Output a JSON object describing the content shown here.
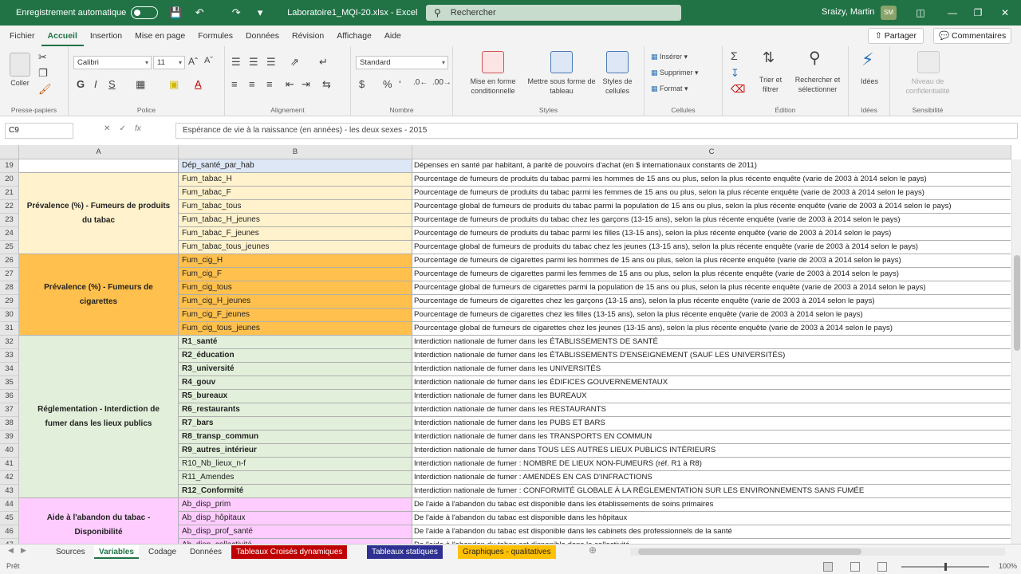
{
  "titlebar": {
    "autosave_label": "Enregistrement automatique",
    "filename": "Laboratoire1_MQI-20.xlsx",
    "app": "Excel",
    "search_placeholder": "Rechercher",
    "user": "Sraizy, Martin",
    "avatar_initials": "SM"
  },
  "tabs": [
    "Fichier",
    "Accueil",
    "Insertion",
    "Mise en page",
    "Formules",
    "Données",
    "Révision",
    "Affichage",
    "Aide"
  ],
  "share_label": "Partager",
  "comments_label": "Commentaires",
  "ribbon": {
    "clipboard": {
      "label": "Presse-papiers",
      "paste": "Coller"
    },
    "font": {
      "label": "Police",
      "name": "Calibri",
      "size": "11"
    },
    "alignment": {
      "label": "Alignement"
    },
    "number": {
      "label": "Nombre",
      "format": "Standard"
    },
    "styles": {
      "label": "Styles",
      "cond": "Mise en forme conditionnelle",
      "table": "Mettre sous forme de tableau",
      "cell": "Styles de cellules"
    },
    "cells": {
      "label": "Cellules",
      "insert": "Insérer",
      "delete": "Supprimer",
      "format": "Format"
    },
    "editing": {
      "label": "Édition",
      "sort": "Trier et filtrer",
      "find": "Rechercher et sélectionner"
    },
    "ideas": {
      "label": "Idées",
      "btn": "Idées"
    },
    "sensitivity": {
      "label": "Sensibilité",
      "btn": "Niveau de confidentialité"
    }
  },
  "formula_bar": {
    "name_box": "C9",
    "content": "Espérance de vie à la naissance (en années) - les deux sexes - 2015"
  },
  "columns": [
    "A",
    "B",
    "C"
  ],
  "groups": [
    {
      "label": "Prévalence  (%) - Fumeurs de produits du tabac",
      "color": "#fff2cc"
    },
    {
      "label": "Prévalence (%) - Fumeurs de cigarettes",
      "color": "#ffc04d"
    },
    {
      "label": "Réglementation - Interdiction de fumer dans les lieux publics",
      "color": "#e2efda"
    },
    {
      "label": "Aide à l'abandon du tabac - Disponibilité",
      "color": "#ffccff"
    }
  ],
  "rows": [
    {
      "n": "19",
      "b": "Dép_santé_par_hab",
      "c": "Dépenses en santé par habitant, à parité de pouvoirs d'achat (en $ internationaux constants de 2011)",
      "bcolor": "#dde7f5",
      "bold": false
    },
    {
      "n": "20",
      "b": "Fum_tabac_H",
      "c": "Pourcentage de fumeurs de produits du tabac parmi les hommes de 15 ans ou plus, selon la plus récente enquête (varie de 2003 à 2014 selon le pays)",
      "bcolor": "#fff2cc",
      "bold": false
    },
    {
      "n": "21",
      "b": "Fum_tabac_F",
      "c": "Pourcentage de fumeurs de produits du tabac parmi les femmes de 15 ans ou plus, selon la plus récente enquête (varie de 2003 à 2014 selon le pays)",
      "bcolor": "#fff2cc",
      "bold": false
    },
    {
      "n": "22",
      "b": "Fum_tabac_tous",
      "c": "Pourcentage global de fumeurs de produits du tabac parmi la population de 15 ans ou plus, selon la plus récente enquête (varie de 2003 à 2014 selon le pays)",
      "bcolor": "#fff2cc",
      "bold": false
    },
    {
      "n": "23",
      "b": "Fum_tabac_H_jeunes",
      "c": "Pourcentage de fumeurs de produits du tabac chez les garçons (13-15 ans), selon la plus récente enquête (varie de 2003 à 2014 selon le pays)",
      "bcolor": "#fff2cc",
      "bold": false
    },
    {
      "n": "24",
      "b": "Fum_tabac_F_jeunes",
      "c": "Pourcentage de fumeurs de produits du tabac parmi les filles (13-15 ans), selon la plus récente enquête (varie de 2003 à 2014 selon le pays)",
      "bcolor": "#fff2cc",
      "bold": false
    },
    {
      "n": "25",
      "b": "Fum_tabac_tous_jeunes",
      "c": "Pourcentage global de fumeurs de produits du tabac chez les jeunes (13-15 ans), selon la plus récente enquête (varie de 2003 à 2014 selon le pays)",
      "bcolor": "#fff2cc",
      "bold": false
    },
    {
      "n": "26",
      "b": "Fum_cig_H",
      "c": "Pourcentage de fumeurs de cigarettes parmi les hommes de 15 ans ou plus, selon la plus récente enquête (varie de 2003 à 2014 selon le pays)",
      "bcolor": "#ffc04d",
      "bold": false
    },
    {
      "n": "27",
      "b": "Fum_cig_F",
      "c": "Pourcentage de fumeurs de cigarettes parmi les femmes de 15 ans ou plus, selon la plus récente enquête (varie de 2003 à 2014 selon le pays)",
      "bcolor": "#ffc04d",
      "bold": false
    },
    {
      "n": "28",
      "b": "Fum_cig_tous",
      "c": "Pourcentage global de fumeurs de cigarettes parmi la population de 15 ans ou plus, selon la plus récente enquête (varie de 2003 à 2014 selon le pays)",
      "bcolor": "#ffc04d",
      "bold": false
    },
    {
      "n": "29",
      "b": "Fum_cig_H_jeunes",
      "c": "Pourcentage de fumeurs de cigarettes chez les garçons (13-15 ans), selon la plus récente enquête (varie de 2003 à 2014 selon le pays)",
      "bcolor": "#ffc04d",
      "bold": false
    },
    {
      "n": "30",
      "b": "Fum_cig_F_jeunes",
      "c": "Pourcentage de fumeurs de cigarettes chez les filles (13-15 ans), selon la plus récente enquête (varie de 2003 à 2014 selon le pays)",
      "bcolor": "#ffc04d",
      "bold": false
    },
    {
      "n": "31",
      "b": "Fum_cig_tous_jeunes",
      "c": "Pourcentage global de fumeurs de cigarettes chez les jeunes (13-15 ans), selon la plus récente enquête (varie de 2003 à 2014 selon le pays)",
      "bcolor": "#ffc04d",
      "bold": false
    },
    {
      "n": "32",
      "b": "R1_santé",
      "c": "Interdiction nationale de fumer dans les ÉTABLISSEMENTS DE SANTÉ",
      "bcolor": "#e2efda",
      "bold": true
    },
    {
      "n": "33",
      "b": "R2_éducation",
      "c": "Interdiction nationale de fumer dans les ÉTABLISSEMENTS D'ENSEIGNEMENT (SAUF LES UNIVERSITÉS)",
      "bcolor": "#e2efda",
      "bold": true
    },
    {
      "n": "34",
      "b": "R3_université",
      "c": "Interdiction nationale de fumer dans les UNIVERSITÉS",
      "bcolor": "#e2efda",
      "bold": true
    },
    {
      "n": "35",
      "b": "R4_gouv",
      "c": "Interdiction nationale de fumer dans les ÉDIFICES GOUVERNEMENTAUX",
      "bcolor": "#e2efda",
      "bold": true
    },
    {
      "n": "36",
      "b": "R5_bureaux",
      "c": "Interdiction nationale de fumer dans les BUREAUX",
      "bcolor": "#e2efda",
      "bold": true
    },
    {
      "n": "37",
      "b": "R6_restaurants",
      "c": "Interdiction nationale de fumer dans les RESTAURANTS",
      "bcolor": "#e2efda",
      "bold": true
    },
    {
      "n": "38",
      "b": "R7_bars",
      "c": "Interdiction nationale de fumer dans les PUBS ET BARS",
      "bcolor": "#e2efda",
      "bold": true
    },
    {
      "n": "39",
      "b": "R8_transp_commun",
      "c": "Interdiction nationale de fumer dans les TRANSPORTS EN COMMUN",
      "bcolor": "#e2efda",
      "bold": true
    },
    {
      "n": "40",
      "b": "R9_autres_intérieur",
      "c": "Interdiction nationale de fumer dans TOUS LES AUTRES LIEUX PUBLICS INTÉRIEURS",
      "bcolor": "#e2efda",
      "bold": true
    },
    {
      "n": "41",
      "b": "R10_Nb_lieux_n-f",
      "c": "Interdiction nationale de fumer : NOMBRE DE LIEUX NON-FUMEURS (réf. R1 à R8)",
      "bcolor": "#e2efda",
      "bold": false
    },
    {
      "n": "42",
      "b": "R11_Amendes",
      "c": "Interdiction nationale de fumer : AMENDES EN CAS D'INFRACTIONS",
      "bcolor": "#e2efda",
      "bold": false
    },
    {
      "n": "43",
      "b": "R12_Conformité",
      "c": "Interdiction nationale de fumer : CONFORMITÉ GLOBALE À LA RÉGLEMENTATION SUR LES ENVIRONNEMENTS SANS FUMÉE",
      "bcolor": "#e2efda",
      "bold": true
    },
    {
      "n": "44",
      "b": "Ab_disp_prim",
      "c": "De l'aide à l'abandon du tabac est disponible dans les établissements de soins primaires",
      "bcolor": "#ffccff",
      "bold": false
    },
    {
      "n": "45",
      "b": "Ab_disp_hôpitaux",
      "c": "De l'aide à l'abandon du tabac est disponible dans les hôpitaux",
      "bcolor": "#ffccff",
      "bold": false
    },
    {
      "n": "46",
      "b": "Ab_disp_prof_santé",
      "c": "De l'aide à l'abandon du tabac est disponible dans les cabinets des professionnels de la santé",
      "bcolor": "#ffccff",
      "bold": false
    },
    {
      "n": "47",
      "b": "Ab_disp_collectivité",
      "c": "De l'aide à l'abandon du tabac est disponible dans la collectivité",
      "bcolor": "#ffccff",
      "bold": false
    }
  ],
  "sheets": [
    {
      "name": "Sources",
      "color": ""
    },
    {
      "name": "Variables",
      "color": "",
      "active": true
    },
    {
      "name": "Codage",
      "color": ""
    },
    {
      "name": "Données",
      "color": ""
    },
    {
      "name": "Tableaux Croisés dynamiques",
      "color": "#c00000"
    },
    {
      "name": "Tableaux statiques",
      "color": "#2e3192"
    },
    {
      "name": "Graphiques - qualitatives",
      "color": "#ffc000"
    }
  ],
  "status": {
    "left": "Prêt",
    "zoom": "100%"
  }
}
